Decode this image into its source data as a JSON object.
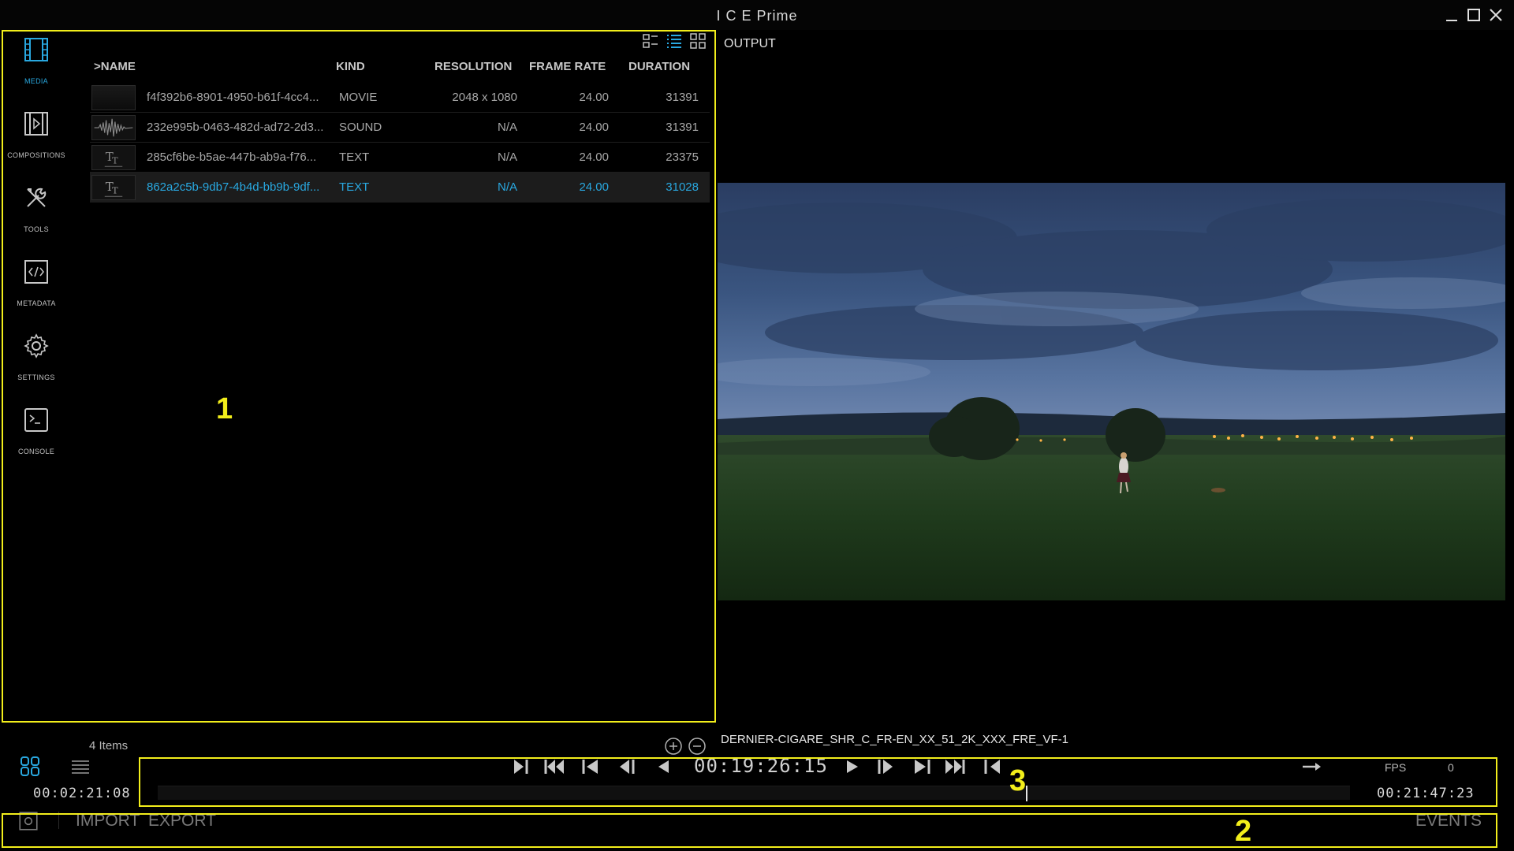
{
  "window": {
    "title": "I C E Prime",
    "controls": [
      "minimize-icon",
      "maximize-icon",
      "close-icon"
    ]
  },
  "nav": {
    "items": [
      {
        "label": "MEDIA",
        "icon": "film-icon",
        "active": true
      },
      {
        "label": "COMPOSITIONS",
        "icon": "composition-icon",
        "active": false
      },
      {
        "label": "TOOLS",
        "icon": "tools-icon",
        "active": false
      },
      {
        "label": "METADATA",
        "icon": "code-icon",
        "active": false
      },
      {
        "label": "SETTINGS",
        "icon": "gear-icon",
        "active": false
      },
      {
        "label": "CONSOLE",
        "icon": "terminal-icon",
        "active": false
      }
    ]
  },
  "media": {
    "columns": {
      "name": ">NAME",
      "kind": "KIND",
      "resolution": "RESOLUTION",
      "frame_rate": "FRAME RATE",
      "duration": "DURATION"
    },
    "rows": [
      {
        "name": "f4f392b6-8901-4950-b61f-4cc4...",
        "kind": "MOVIE",
        "resolution": "2048 x 1080",
        "frame_rate": "24.00",
        "duration": "31391",
        "thumb": "movie",
        "selected": false
      },
      {
        "name": "232e995b-0463-482d-ad72-2d3...",
        "kind": "SOUND",
        "resolution": "N/A",
        "frame_rate": "24.00",
        "duration": "31391",
        "thumb": "sound",
        "selected": false
      },
      {
        "name": "285cf6be-b5ae-447b-ab9a-f76...",
        "kind": "TEXT",
        "resolution": "N/A",
        "frame_rate": "24.00",
        "duration": "23375",
        "thumb": "text",
        "selected": false
      },
      {
        "name": "862a2c5b-9db7-4b4d-bb9b-9df...",
        "kind": "TEXT",
        "resolution": "N/A",
        "frame_rate": "24.00",
        "duration": "31028",
        "thumb": "text",
        "selected": true
      }
    ],
    "item_count": "4 Items",
    "timecode": "00:02:21:08"
  },
  "output": {
    "label": "OUTPUT",
    "clip_name": "DERNIER-CIGARE_SHR_C_FR-EN_XX_51_2K_XXX_FRE_VF-1"
  },
  "transport": {
    "current_timecode": "00:19:26:15",
    "end_timecode": "00:21:47:23",
    "fps_label": "FPS",
    "fps_value": "0",
    "playhead_position": 0.728
  },
  "bottom": {
    "import_label": "IMPORT",
    "export_label": "EXPORT",
    "events_label": "EVENTS"
  },
  "annotations": [
    "1",
    "2",
    "3"
  ],
  "colors": {
    "accent": "#29a8e0",
    "annotation": "#f2ee1b",
    "background": "#000000"
  }
}
